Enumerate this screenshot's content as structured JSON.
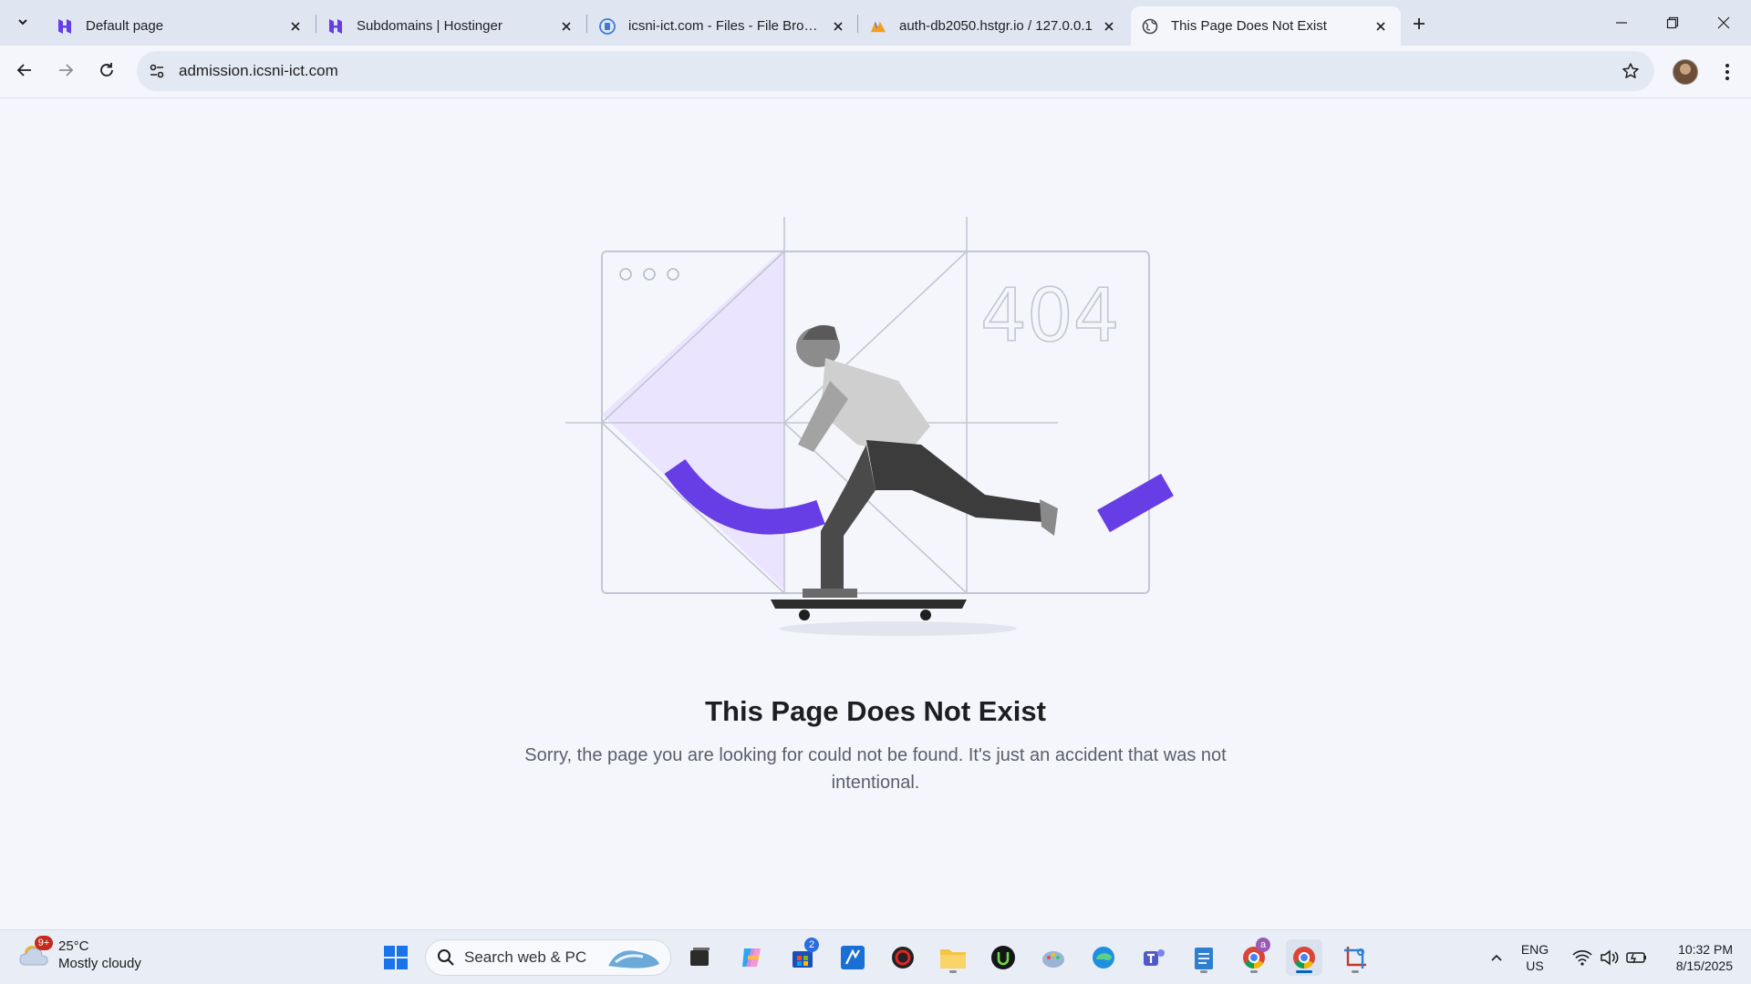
{
  "browser": {
    "tabs": [
      {
        "title": "Default page",
        "favicon": "hostinger-icon",
        "active": false
      },
      {
        "title": "Subdomains | Hostinger",
        "favicon": "hostinger-icon",
        "active": false
      },
      {
        "title": "icsni-ict.com - Files - File Browser",
        "favicon": "file-browser-icon",
        "active": false
      },
      {
        "title": "auth-db2050.hstgr.io / 127.0.0.1",
        "favicon": "phpmyadmin-icon",
        "active": false
      },
      {
        "title": "This Page Does Not Exist",
        "favicon": "globe-icon",
        "active": true
      }
    ],
    "url": "admission.icsni-ict.com"
  },
  "page": {
    "illustration_404": "404",
    "title": "This Page Does Not Exist",
    "message": "Sorry, the page you are looking for could not be found. It's just an accident that was not intentional.",
    "accent_color": "#673de6",
    "accent_light": "#ebe4ff"
  },
  "taskbar": {
    "weather": {
      "temp": "25°C",
      "condition": "Mostly cloudy",
      "badge": "9+"
    },
    "search_placeholder": "Search web & PC",
    "store_badge": "2",
    "chrome_badge": "a",
    "language": {
      "lang": "ENG",
      "region": "US"
    },
    "clock": {
      "time": "10:32 PM",
      "date": "8/15/2025"
    }
  }
}
